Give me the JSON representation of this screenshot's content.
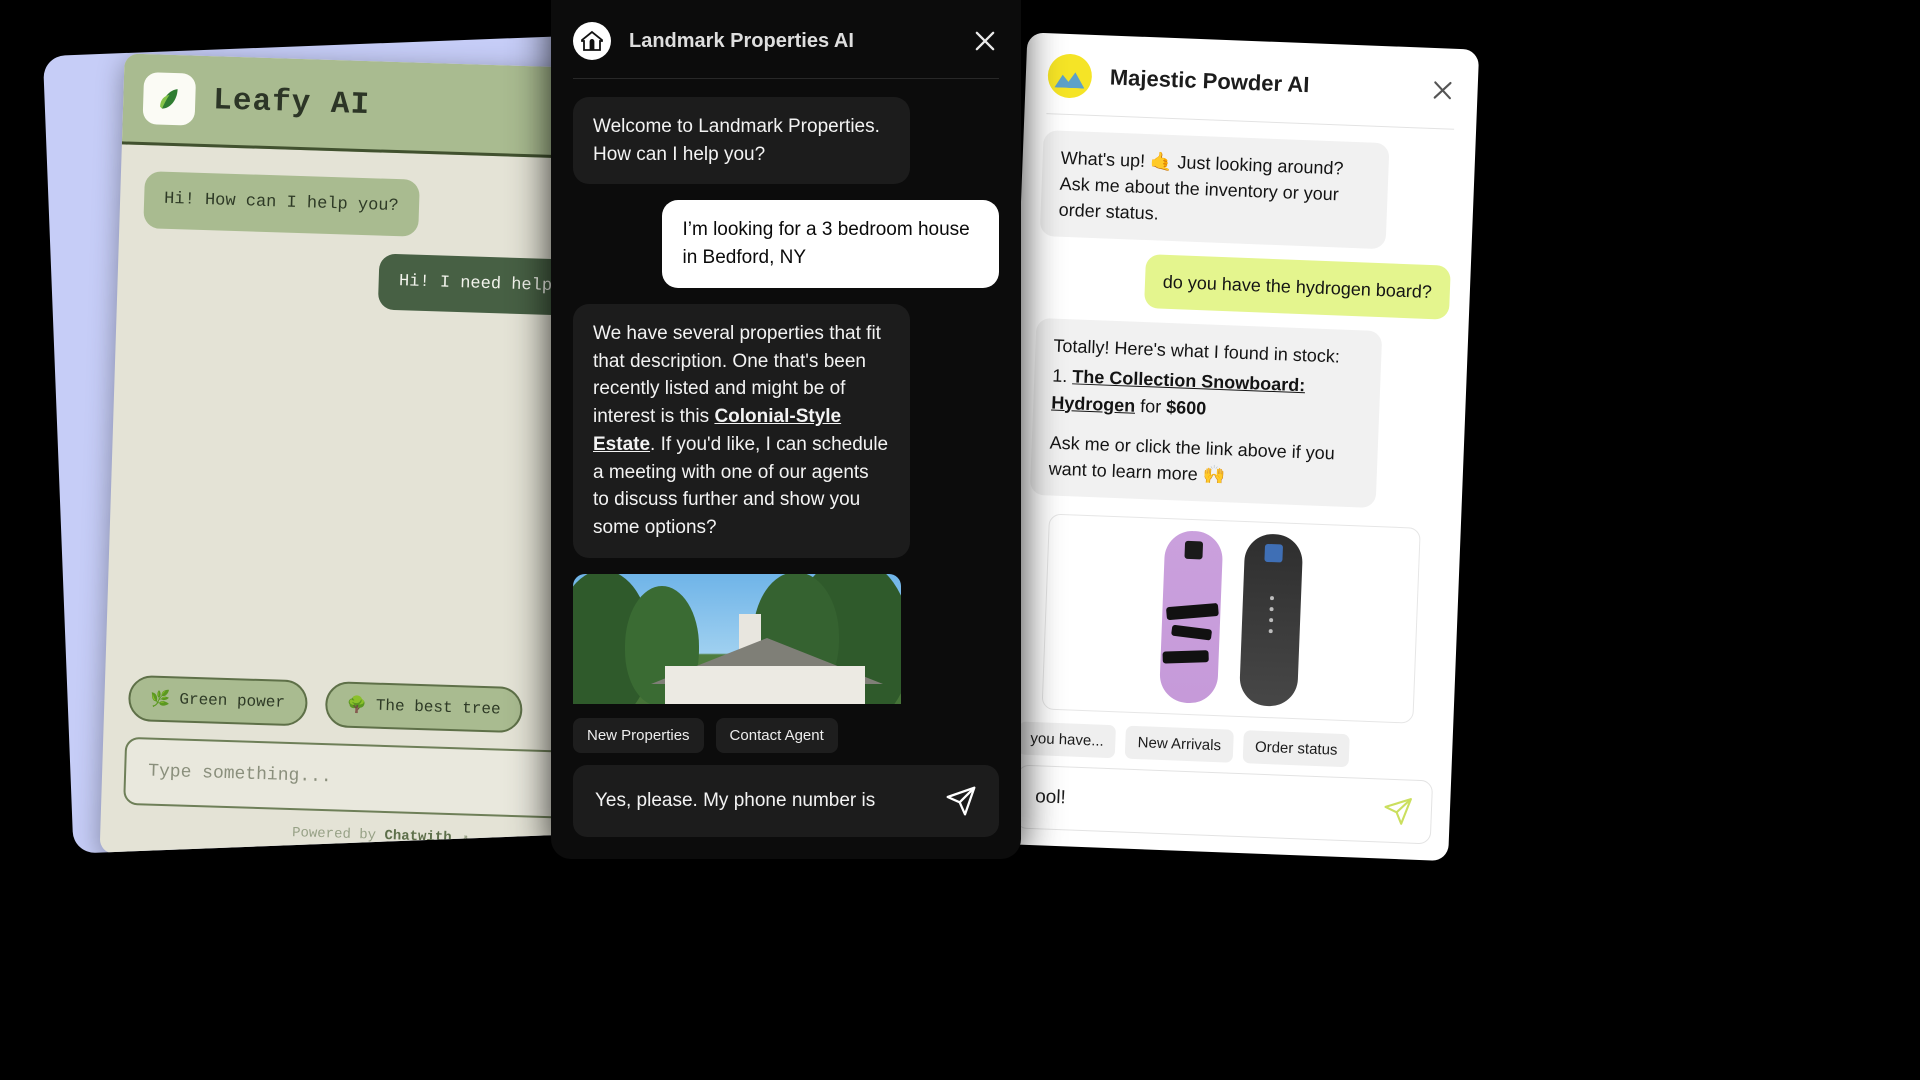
{
  "leafy": {
    "title": "Leafy AI",
    "logo_icon": "leaf-logo-icon",
    "refresh_icon": "refresh-icon",
    "close_icon": "close-icon",
    "messages": [
      {
        "role": "bot",
        "text": "Hi! How can I help you?"
      },
      {
        "role": "user",
        "text": "Hi! I need help with..."
      }
    ],
    "chips": [
      {
        "emoji": "🌿",
        "label": "Green power"
      },
      {
        "emoji": "🌳",
        "label": "The best tree"
      }
    ],
    "input_placeholder": "Type something...",
    "footer_prefix": "Powered by ",
    "footer_brand": "Chatwith",
    "footer_suffix": " ↗"
  },
  "landmark": {
    "title": "Landmark Properties AI",
    "logo_icon": "house-arch-logo-icon",
    "close_icon": "close-icon",
    "messages": [
      {
        "role": "bot",
        "text": "Welcome to Landmark Properties. How can I help you?"
      },
      {
        "role": "user",
        "text": "I’m looking for a 3 bedroom house in Bedford, NY"
      },
      {
        "role": "bot",
        "prefix": "We have several properties that fit that description. One that's been recently listed and might be of interest is this ",
        "link": "Colonial-Style Estate",
        "suffix": ". If you'd like, I can schedule a meeting with one of our agents to discuss further and show you some options?"
      }
    ],
    "property_card_alt": "colonial-style house exterior photo",
    "chips": [
      {
        "label": "New Properties"
      },
      {
        "label": "Contact Agent"
      }
    ],
    "input_value": "Yes, please. My phone number is",
    "send_icon": "send-icon"
  },
  "majestic": {
    "title": "Majestic Powder AI",
    "logo_icon": "snowboard-mountain-logo-icon",
    "close_icon": "close-icon",
    "messages": [
      {
        "role": "bot",
        "text": "What's up! 🤙 Just looking around? Ask me about the inventory or your order status."
      },
      {
        "role": "user",
        "text": "do you have the hydrogen board?"
      },
      {
        "role": "bot",
        "intro": "Totally! Here's what I found in stock:",
        "item_number": "1.",
        "item_link": "The Collection Snowboard: Hydrogen",
        "item_mid": " for ",
        "item_price": "$600",
        "outro": "Ask me or click the link above if you want to learn more 🙌"
      }
    ],
    "product_card_alt": "two snowboards: purple and dark",
    "chips": [
      {
        "label": "you have..."
      },
      {
        "label": "New Arrivals"
      },
      {
        "label": "Order status"
      }
    ],
    "input_value": "ool!",
    "send_icon": "send-icon"
  }
}
